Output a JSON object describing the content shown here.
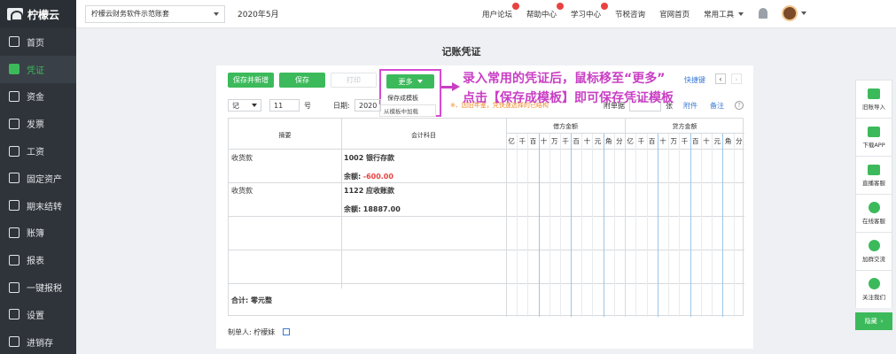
{
  "sidebar": {
    "logo": "柠檬云",
    "items": [
      {
        "label": "首页",
        "icon": "home-icon"
      },
      {
        "label": "凭证",
        "icon": "voucher-icon",
        "active": true
      },
      {
        "label": "资金",
        "icon": "wallet-icon"
      },
      {
        "label": "发票",
        "icon": "invoice-icon"
      },
      {
        "label": "工资",
        "icon": "salary-icon"
      },
      {
        "label": "固定资产",
        "icon": "asset-icon"
      },
      {
        "label": "期末结转",
        "icon": "transfer-icon"
      },
      {
        "label": "账簿",
        "icon": "ledger-icon"
      },
      {
        "label": "报表",
        "icon": "report-icon"
      },
      {
        "label": "一键报税",
        "icon": "tax-icon"
      },
      {
        "label": "设置",
        "icon": "gear-icon"
      },
      {
        "label": "进销存",
        "icon": "inventory-icon"
      }
    ]
  },
  "topbar": {
    "account": "柠檬云财务软件示范账套",
    "period": "2020年5月",
    "links": [
      "用户论坛",
      "帮助中心",
      "学习中心",
      "节税咨询",
      "官网首页",
      "常用工具"
    ]
  },
  "main": {
    "title": "记账凭证",
    "toolbar": {
      "save_new": "保存并新增",
      "save": "保存",
      "print": "打印",
      "more": "更多",
      "menu_save_template": "保存成模板",
      "menu_load_template": "从模板中加载",
      "shortcut": "快捷键"
    },
    "header_row": {
      "voucher_word": "记",
      "voucher_no": "11",
      "no_label": "号",
      "date_label": "日期:",
      "date_value": "2020",
      "warn": "※、因旧年鉴，凭快速选择的已结构",
      "attach_label": "附单据",
      "attach_unit": "张",
      "attachment": "附件",
      "remark": "备注",
      "help": "?"
    },
    "table": {
      "col_summary": "摘要",
      "col_subject": "会计科目",
      "col_debit": "借方金额",
      "col_credit": "贷方金额",
      "digits": [
        "亿",
        "千",
        "百",
        "十",
        "万",
        "千",
        "百",
        "十",
        "元",
        "角",
        "分"
      ],
      "rows": [
        {
          "summary": "收货款",
          "subject": "1002 银行存款",
          "balance_label": "余额:",
          "balance": "-600.00",
          "negative": true
        },
        {
          "summary": "收货款",
          "subject": "1122 应收账款",
          "balance_label": "余额:",
          "balance": "18887.00",
          "negative": false
        }
      ],
      "total": "合计: 零元整"
    },
    "maker": "制单人: 柠檬妹"
  },
  "annotation": {
    "line1": "录入常用的凭证后，鼠标移至“更多”",
    "line2": "点击【保存成模板】即可保存凭证模板"
  },
  "right_bar": {
    "items": [
      {
        "label": "旧账导入",
        "icon": "download-icon"
      },
      {
        "label": "下载APP",
        "icon": "phone-icon"
      },
      {
        "label": "直播客服",
        "icon": "video-icon"
      },
      {
        "label": "在线客服",
        "icon": "person-icon"
      },
      {
        "label": "加群交流",
        "icon": "group-icon"
      },
      {
        "label": "关注我们",
        "icon": "wechat-icon"
      }
    ],
    "hide": "隐藏"
  }
}
